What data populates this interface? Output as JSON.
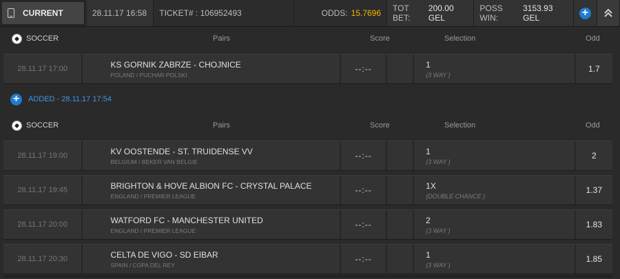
{
  "header": {
    "current_label": "CURRENT",
    "datetime": "28.11.17 16:58",
    "ticket_label": "TICKET# :",
    "ticket_number": "106952493",
    "odds_label": "ODDS:",
    "odds_value": "15.7696",
    "tot_bet_label": "TOT BET:",
    "tot_bet_value": "200.00 GEL",
    "poss_win_label": "POSS WIN:",
    "poss_win_value": "3153.93 GEL",
    "plus_icon": "+",
    "collapse_icon": "︽"
  },
  "columns": {
    "sport": "SOCCER",
    "pairs": "Pairs",
    "score": "Score",
    "selection": "Selection",
    "odd": "Odd"
  },
  "added": {
    "label": "ADDED - 28.11.17 17:54",
    "icon": "+"
  },
  "section1": [
    {
      "date": "28.11.17 17:00",
      "teams": "KS GORNIK ZABRZE - CHOJNICE",
      "league": "POLAND / PUCHAR POLSKI",
      "score": "--:--",
      "selection": "1",
      "type": "(3 WAY )",
      "odd": "1.7"
    }
  ],
  "section2": [
    {
      "date": "28.11.17 19:00",
      "teams": "KV OOSTENDE - ST. TRUIDENSE VV",
      "league": "BELGIUM / BEKER VAN BELGIE",
      "score": "--:--",
      "selection": "1",
      "type": "(3 WAY )",
      "odd": "2"
    },
    {
      "date": "28.11.17 19:45",
      "teams": "BRIGHTON & HOVE ALBION FC - CRYSTAL PALACE",
      "league": "ENGLAND / PREMIER LEAGUE",
      "score": "--:--",
      "selection": "1X",
      "type": "(DOUBLE CHANCE )",
      "odd": "1.37"
    },
    {
      "date": "28.11.17 20:00",
      "teams": "WATFORD FC - MANCHESTER UNITED",
      "league": "ENGLAND / PREMIER LEAGUE",
      "score": "--:--",
      "selection": "2",
      "type": "(3 WAY )",
      "odd": "1.83"
    },
    {
      "date": "28.11.17 20:30",
      "teams": "CELTA DE VIGO - SD EIBAR",
      "league": "SPAIN / COPA DEL REY",
      "score": "--:--",
      "selection": "1",
      "type": "(3 WAY )",
      "odd": "1.85"
    }
  ],
  "colors": {
    "accent_blue": "#1e7ccf",
    "odds_yellow": "#f2b800",
    "added_blue": "#3e98e4"
  }
}
